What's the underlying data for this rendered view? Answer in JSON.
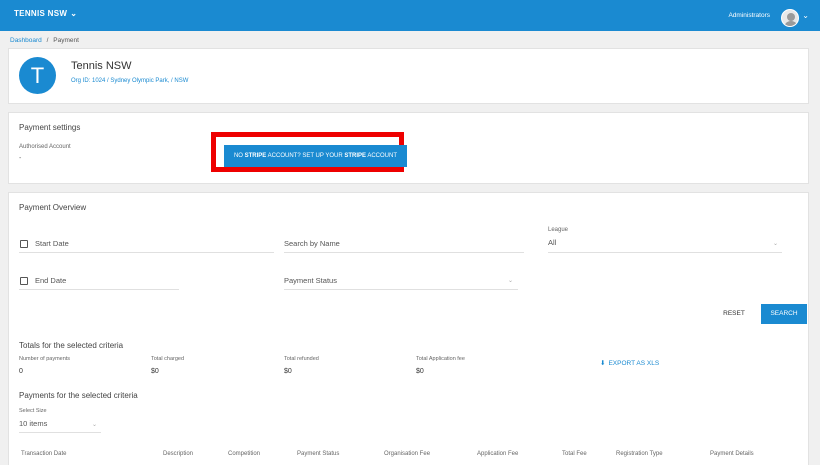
{
  "header": {
    "org_switcher_label": "TENNIS NSW",
    "user_role": "Administrators"
  },
  "breadcrumb": {
    "home": "Dashboard",
    "separator": "/",
    "current": "Payment"
  },
  "organisation": {
    "initial": "T",
    "name": "Tennis NSW",
    "meta": "Org ID: 1024 / Sydney Olympic Park, / NSW"
  },
  "payment_settings": {
    "title": "Payment settings",
    "account_label": "Authorised Account",
    "account_value": "-",
    "stripe_btn_prefix": "NO ",
    "stripe_btn_word1": "STRIPE",
    "stripe_btn_middle": " ACCOUNT? SET UP YOUR ",
    "stripe_btn_word2": "STRIPE",
    "stripe_btn_suffix": " ACCOUNT"
  },
  "overview": {
    "title": "Payment Overview",
    "start_date_label": "Start Date",
    "end_date_label": "End Date",
    "search_name_placeholder": "Search by Name",
    "payment_status_placeholder": "Payment Status",
    "league_label": "League",
    "league_value": "All",
    "reset_label": "RESET",
    "search_label": "SEARCH"
  },
  "totals": {
    "title": "Totals for the selected criteria",
    "stats": [
      {
        "label": "Number of payments",
        "value": "0"
      },
      {
        "label": "Total charged",
        "value": "$0"
      },
      {
        "label": "Total refunded",
        "value": "$0"
      },
      {
        "label": "Total Application fee",
        "value": "$0"
      }
    ],
    "export_label": "EXPORT AS XLS"
  },
  "payments": {
    "title": "Payments for the selected criteria",
    "select_size_label": "Select Size",
    "select_size_value": "10 items",
    "columns": [
      "Transaction Date",
      "Description",
      "Competition",
      "Payment Status",
      "Organisation Fee",
      "Application Fee",
      "Total Fee",
      "Registration Type",
      "Payment Details"
    ]
  },
  "colors": {
    "primary": "#1a8ad1",
    "highlight": "#ee0000",
    "background": "#f0f0f0"
  },
  "icons": [
    "chevron-down-icon",
    "user-avatar-icon",
    "download-icon",
    "checkbox-icon"
  ]
}
